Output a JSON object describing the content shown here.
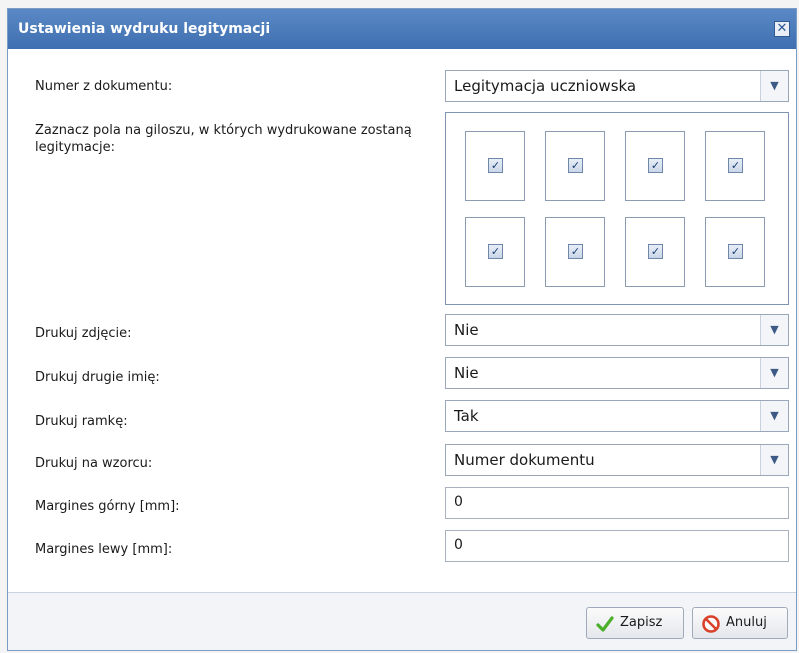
{
  "dialog": {
    "title": "Ustawienia wydruku legitymacji",
    "close_symbol": "✕"
  },
  "form": {
    "numer_label": "Numer z dokumentu:",
    "numer_value": "Legitymacja uczniowska",
    "giloszu_label": "Zaznacz pola na giloszu, w których wydrukowane zostaną legitymacje:",
    "giloszu_fields_checked": [
      true,
      true,
      true,
      true,
      true,
      true,
      true,
      true
    ],
    "drukuj_zdjecie_label": "Drukuj zdjęcie:",
    "drukuj_zdjecie_value": "Nie",
    "drukuj_drugie_imie_label": "Drukuj drugie imię:",
    "drukuj_drugie_imie_value": "Nie",
    "drukuj_ramke_label": "Drukuj ramkę:",
    "drukuj_ramke_value": "Tak",
    "drukuj_na_wzorcu_label": "Drukuj na wzorcu:",
    "drukuj_na_wzorcu_value": "Numer dokumentu",
    "margines_gorny_label": "Margines górny [mm]:",
    "margines_gorny_value": "0",
    "margines_lewy_label": "Margines lewy [mm]:",
    "margines_lewy_value": "0"
  },
  "buttons": {
    "save_label": "Zapisz",
    "save_icon": "checkmark-icon",
    "cancel_label": "Anuluj",
    "cancel_icon": "no-entry-icon"
  },
  "colors": {
    "titlebar": "#4a7bbd",
    "accent_green": "#4caf2a",
    "accent_red": "#d9412b"
  }
}
